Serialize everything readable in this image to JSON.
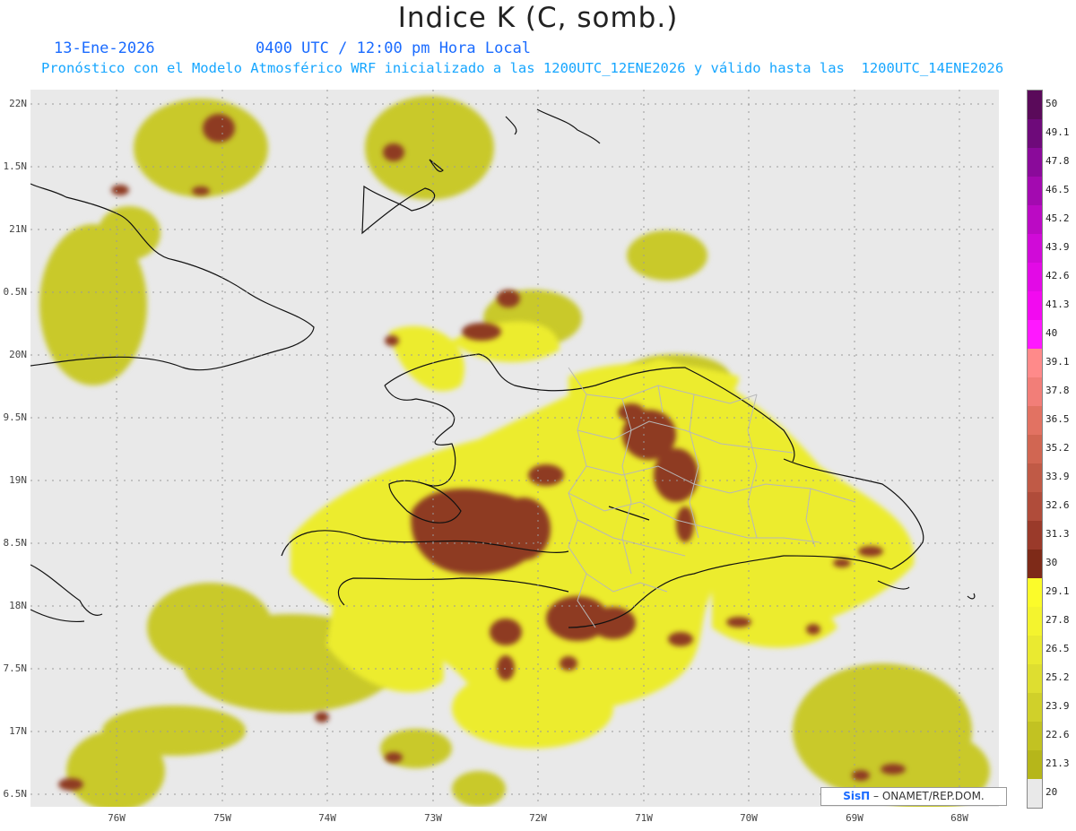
{
  "header": {
    "title": "Indice K (C, somb.)",
    "date": "13-Ene-2026",
    "time": "0400 UTC / 12:00 pm Hora Local",
    "model_line": "Pronóstico con el Modelo Atmosférico WRF inicializado a las 1200UTC_12ENE2026 y válido hasta las  1200UTC_14ENE2026"
  },
  "axes": {
    "lat_labels": [
      "22N",
      "1.5N",
      "21N",
      "0.5N",
      "20N",
      "9.5N",
      "19N",
      "8.5N",
      "18N",
      "7.5N",
      "17N",
      "6.5N"
    ],
    "lon_labels": [
      "76W",
      "75W",
      "74W",
      "73W",
      "72W",
      "71W",
      "70W",
      "69W",
      "68W"
    ]
  },
  "colorbar": {
    "labels": [
      "50",
      "49.1",
      "47.8",
      "46.5",
      "45.2",
      "43.9",
      "42.6",
      "41.3",
      "40",
      "39.1",
      "37.8",
      "36.5",
      "35.2",
      "33.9",
      "32.6",
      "31.3",
      "30",
      "29.1",
      "27.8",
      "26.5",
      "25.2",
      "23.9",
      "22.6",
      "21.3",
      "20"
    ],
    "colors": [
      "#5a0a5a",
      "#6e0a7a",
      "#8a0a9a",
      "#a30ab0",
      "#bb0ac4",
      "#d00ad8",
      "#e20ae6",
      "#f20af0",
      "#ff18ff",
      "#ff8a8a",
      "#f27e78",
      "#e27262",
      "#d16652",
      "#c05a46",
      "#b04c3a",
      "#9a3a2a",
      "#7e2a18",
      "#fbfb2a",
      "#f4f42e",
      "#eaea30",
      "#dede30",
      "#d0d02a",
      "#c2c222",
      "#b6b61a",
      "#e9e9e9"
    ]
  },
  "credit": {
    "logo": "SisΠ",
    "text": "– ONAMET/REP.DOM."
  },
  "colors": {
    "k_high": "#8e3a24",
    "k_mid": "#eaea30",
    "k_low": "#c8c82a",
    "background": "#e9e9e9",
    "title_blue": "#1a6bff",
    "subtitle_cyan": "#16a6ff"
  }
}
